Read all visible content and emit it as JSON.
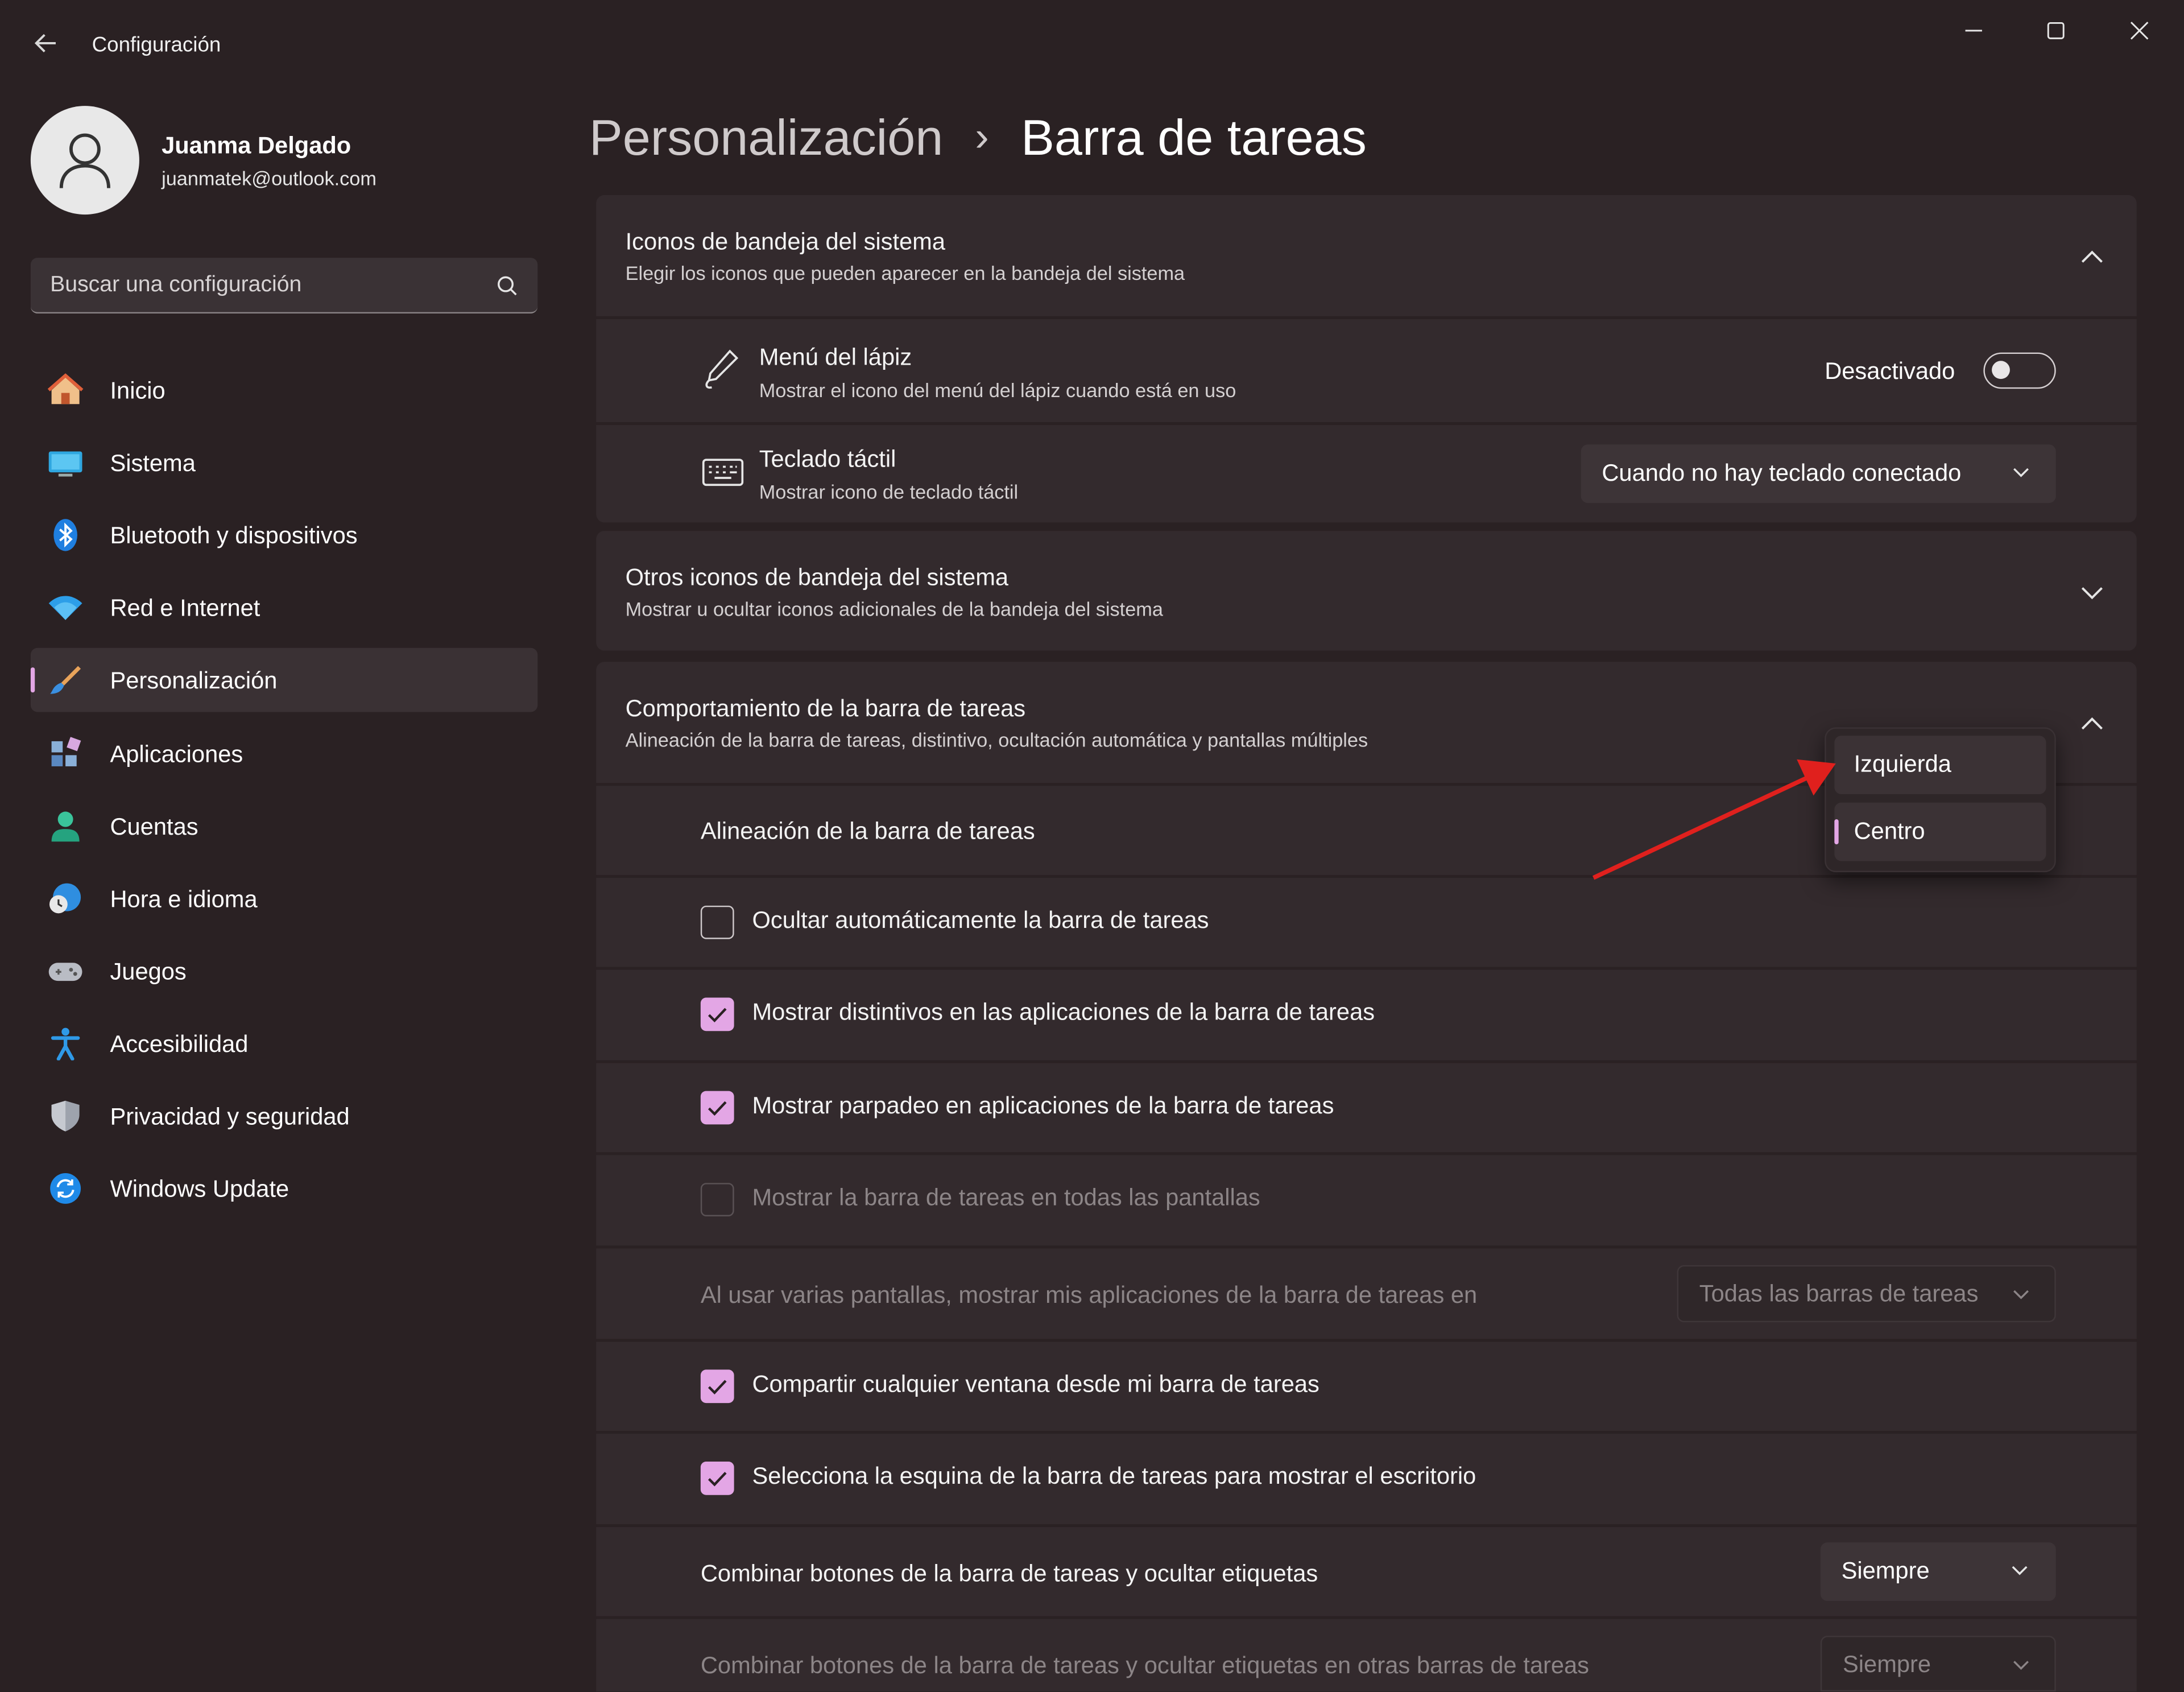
{
  "window": {
    "title": "Configuración",
    "back_icon": "arrow-left-icon",
    "controls": [
      "minimize-icon",
      "maximize-icon",
      "close-icon"
    ]
  },
  "user": {
    "name": "Juanma Delgado",
    "email": "juanmatek@outlook.com"
  },
  "search": {
    "placeholder": "Buscar una configuración"
  },
  "sidebar": {
    "items": [
      {
        "label": "Inicio",
        "icon": "home-icon"
      },
      {
        "label": "Sistema",
        "icon": "system-monitor-icon"
      },
      {
        "label": "Bluetooth y dispositivos",
        "icon": "bluetooth-icon"
      },
      {
        "label": "Red e Internet",
        "icon": "wifi-icon"
      },
      {
        "label": "Personalización",
        "icon": "paintbrush-icon",
        "active": true
      },
      {
        "label": "Aplicaciones",
        "icon": "apps-icon"
      },
      {
        "label": "Cuentas",
        "icon": "account-icon"
      },
      {
        "label": "Hora e idioma",
        "icon": "clock-globe-icon"
      },
      {
        "label": "Juegos",
        "icon": "gamepad-icon"
      },
      {
        "label": "Accesibilidad",
        "icon": "accessibility-icon"
      },
      {
        "label": "Privacidad y seguridad",
        "icon": "shield-icon"
      },
      {
        "label": "Windows Update",
        "icon": "update-sync-icon"
      }
    ]
  },
  "breadcrumb": {
    "parent": "Personalización",
    "separator": "›",
    "current": "Barra de tareas"
  },
  "tray": {
    "title": "Iconos de bandeja del sistema",
    "subtitle": "Elegir los iconos que pueden aparecer en la bandeja del sistema",
    "pen": {
      "title": "Menú del lápiz",
      "subtitle": "Mostrar el icono del menú del lápiz cuando está en uso",
      "state_label": "Desactivado",
      "on": false
    },
    "keyboard": {
      "title": "Teclado táctil",
      "subtitle": "Mostrar icono de teclado táctil",
      "value": "Cuando no hay teclado conectado"
    }
  },
  "other_tray": {
    "title": "Otros iconos de bandeja del sistema",
    "subtitle": "Mostrar u ocultar iconos adicionales de la bandeja del sistema"
  },
  "behavior": {
    "title": "Comportamiento de la barra de tareas",
    "subtitle": "Alineación de la barra de tareas, distintivo, ocultación automática y pantallas múltiples",
    "alignment_label": "Alineación de la barra de tareas",
    "alignment_options": [
      "Izquierda",
      "Centro"
    ],
    "alignment_selected": "Centro",
    "checks": [
      {
        "label": "Ocultar automáticamente la barra de tareas",
        "checked": false,
        "disabled": false
      },
      {
        "label": "Mostrar distintivos en las aplicaciones de la barra de tareas",
        "checked": true,
        "disabled": false
      },
      {
        "label": "Mostrar parpadeo en aplicaciones de la barra de tareas",
        "checked": true,
        "disabled": false
      },
      {
        "label": "Mostrar la barra de tareas en todas las pantallas",
        "checked": false,
        "disabled": true
      }
    ],
    "multi_screen": {
      "label": "Al usar varias pantallas, mostrar mis aplicaciones de la barra de tareas en",
      "value": "Todas las barras de tareas"
    },
    "checks2": [
      {
        "label": "Compartir cualquier ventana desde mi barra de tareas",
        "checked": true
      },
      {
        "label": "Selecciona la esquina de la barra de tareas para mostrar el escritorio",
        "checked": true
      }
    ],
    "combine": {
      "label": "Combinar botones de la barra de tareas y ocultar etiquetas",
      "value": "Siempre"
    },
    "combine_other": {
      "label": "Combinar botones de la barra de tareas y ocultar etiquetas en otras barras de tareas",
      "value": "Siempre"
    }
  },
  "colors": {
    "accent": "#e3a6e5",
    "annotation_arrow": "#e0201d"
  }
}
